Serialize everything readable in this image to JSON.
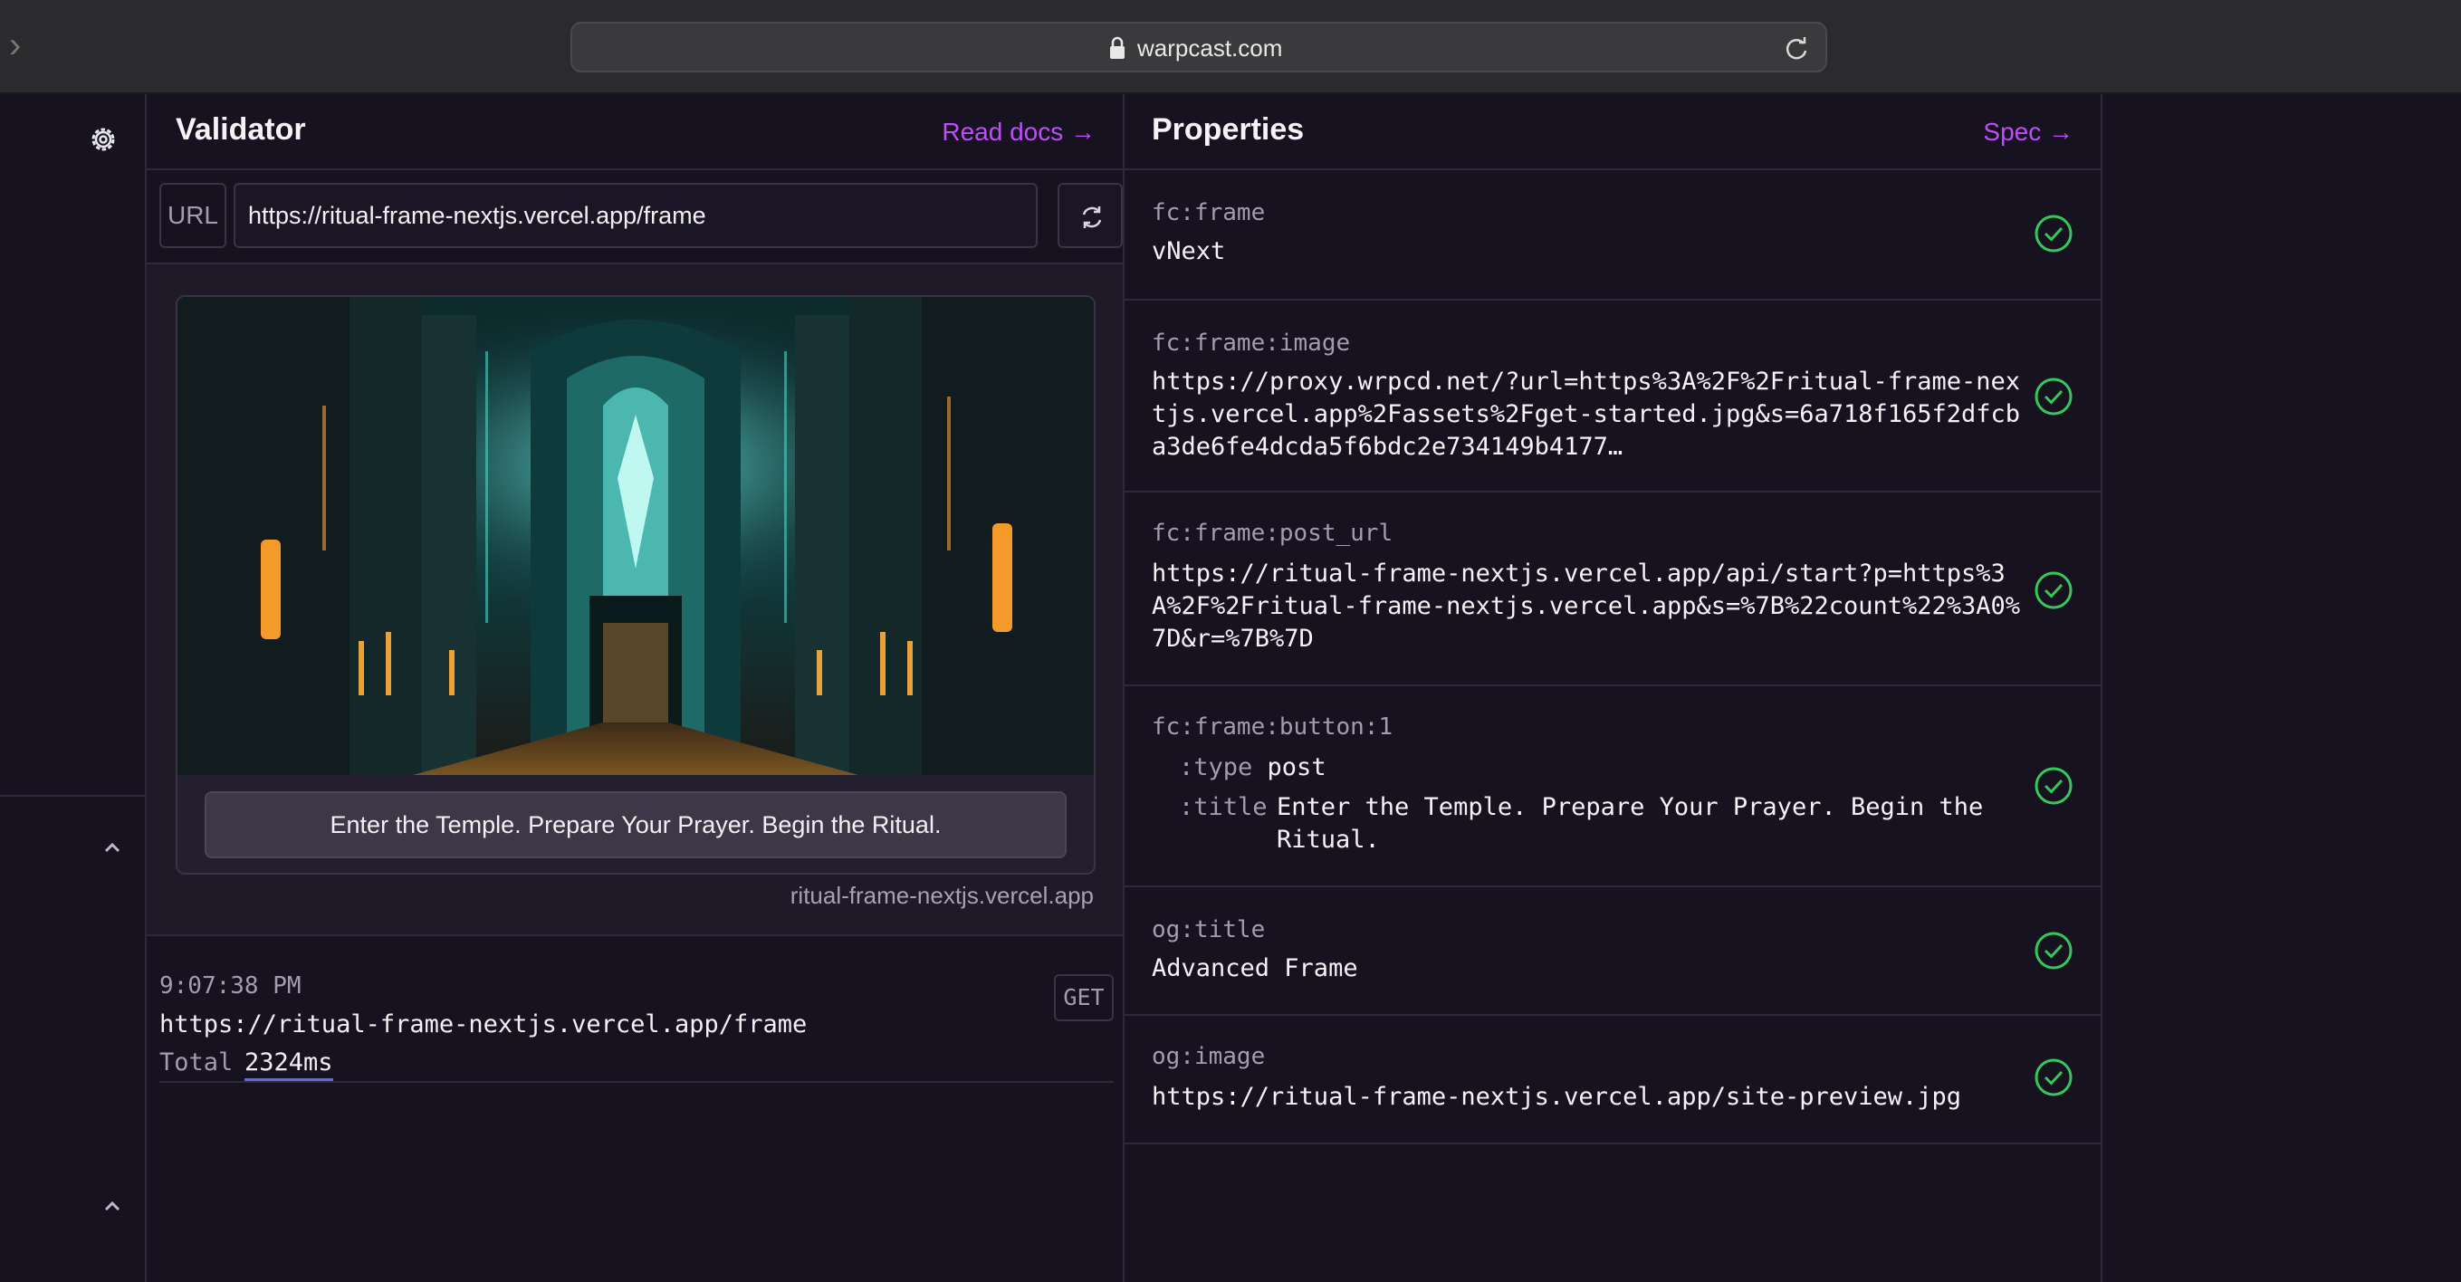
{
  "browser": {
    "domain": "warpcast.com"
  },
  "validator": {
    "title": "Validator",
    "read_docs": "Read docs →",
    "url_label": "URL",
    "url_value": "https://ritual-frame-nextjs.vercel.app/frame",
    "frame_button": "Enter the Temple. Prepare Your Prayer. Begin the Ritual.",
    "frame_host": "ritual-frame-nextjs.vercel.app",
    "log": {
      "time": "9:07:38 PM",
      "url": "https://ritual-frame-nextjs.vercel.app/frame",
      "total_label": "Total",
      "total_value": "2324ms",
      "method": "GET"
    }
  },
  "properties": {
    "title": "Properties",
    "spec_link": "Spec →",
    "items": [
      {
        "key": "fc:frame",
        "value": "vNext"
      },
      {
        "key": "fc:frame:image",
        "value": "https://proxy.wrpcd.net/?url=https%3A%2F%2Fritual-frame-nextjs.vercel.app%2Fassets%2Fget-started.jpg&s=6a718f165f2dfcba3de6fe4dcda5f6bdc2e734149b4177…"
      },
      {
        "key": "fc:frame:post_url",
        "value": "https://ritual-frame-nextjs.vercel.app/api/start?p=https%3A%2F%2Fritual-frame-nextjs.vercel.app&s=%7B%22count%22%3A0%7D&r=%7B%7D"
      },
      {
        "key": "fc:frame:button:1",
        "type_key": ":type",
        "type_value": "post",
        "title_key": ":title",
        "title_value": "Enter the Temple. Prepare Your Prayer. Begin the Ritual."
      },
      {
        "key": "og:title",
        "value": "Advanced Frame"
      },
      {
        "key": "og:image",
        "value": "https://ritual-frame-nextjs.vercel.app/site-preview.jpg"
      }
    ]
  },
  "colors": {
    "background": "#17121f",
    "accent": "#c04dfc",
    "success": "#34c759"
  }
}
